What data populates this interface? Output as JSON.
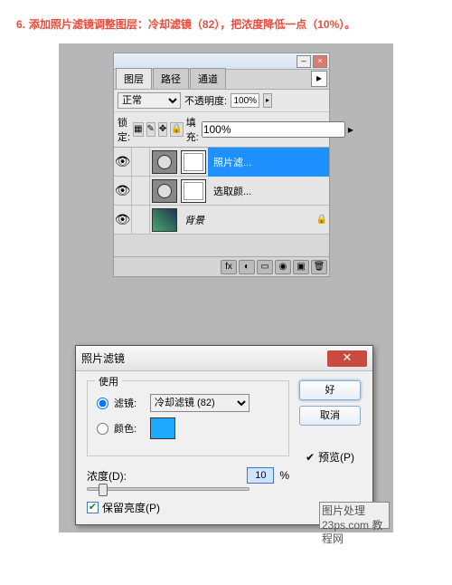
{
  "instruction": {
    "num": "6.",
    "text": "添加照片滤镜调整图层：冷却滤镜（82），把浓度降低一点（10%）。"
  },
  "panel": {
    "tabs": {
      "layers": "图层",
      "paths": "路径",
      "channels": "通道"
    },
    "blend_label": "正常",
    "opacity_label": "不透明度:",
    "opacity_value": "100%",
    "lock_label": "锁定:",
    "fill_label": "填充:",
    "fill_value": "100%",
    "layers": [
      {
        "name": "照片滤...",
        "selected": true,
        "hasMask": true
      },
      {
        "name": "选取颜...",
        "selected": false,
        "hasMask": true
      },
      {
        "name": "背景",
        "selected": false,
        "bg": true
      }
    ]
  },
  "dialog": {
    "title": "照片滤镜",
    "use_label": "使用",
    "filter_label": "滤镜:",
    "filter_value": "冷却滤镜 (82)",
    "color_label": "颜色:",
    "density_label": "浓度(D):",
    "density_value": "10",
    "density_unit": "%",
    "preserve_label": "保留亮度(P)",
    "ok": "好",
    "cancel": "取消",
    "preview": "预览(P)"
  },
  "chart_data": {
    "type": "table",
    "title": "Photo Filter adjustment layer settings",
    "rows": [
      {
        "parameter": "Filter",
        "value": "冷却滤镜 (82)"
      },
      {
        "parameter": "Density",
        "value": "10%"
      },
      {
        "parameter": "Preserve Luminosity",
        "value": "checked"
      },
      {
        "parameter": "Preview",
        "value": "checked"
      }
    ]
  },
  "watermark": {
    "line1": "图片处理",
    "line2": "23ps.com 教程网"
  }
}
